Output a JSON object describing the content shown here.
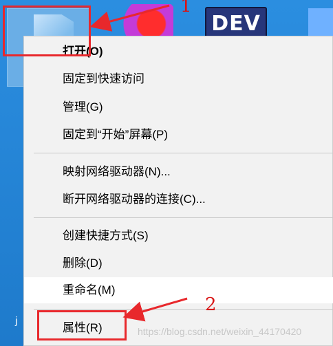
{
  "desktop": {
    "dev_icon_text": "DEV",
    "partial_label": "j"
  },
  "menu": {
    "items": [
      {
        "label": "打开(O)"
      },
      {
        "label": "固定到快速访问"
      },
      {
        "label": "管理(G)"
      },
      {
        "label": "固定到“开始”屏幕(P)"
      },
      {
        "label": "映射网络驱动器(N)..."
      },
      {
        "label": "断开网络驱动器的连接(C)..."
      },
      {
        "label": "创建快捷方式(S)"
      },
      {
        "label": "删除(D)"
      },
      {
        "label": "重命名(M)"
      },
      {
        "label": "属性(R)"
      }
    ]
  },
  "annotations": {
    "label_1": "1",
    "label_2": "2",
    "color": "#e8282c"
  },
  "watermark": "https://blog.csdn.net/weixin_44170420"
}
